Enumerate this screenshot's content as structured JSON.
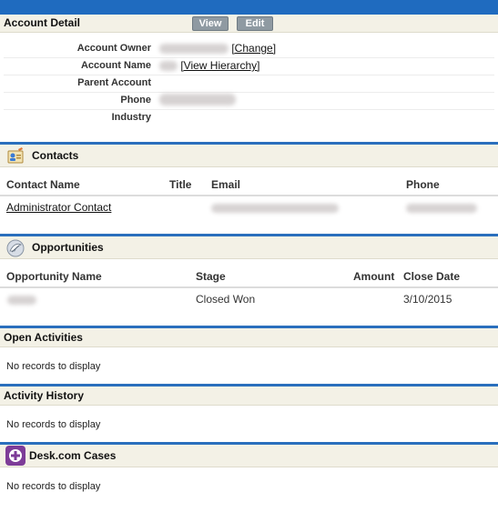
{
  "detail": {
    "title": "Account Detail",
    "view_label": "View",
    "edit_label": "Edit",
    "fields": {
      "owner_label": "Account Owner",
      "change_link": "[Change]",
      "name_label": "Account Name",
      "hierarchy_link": "[View Hierarchy]",
      "parent_label": "Parent Account",
      "phone_label": "Phone",
      "industry_label": "Industry"
    }
  },
  "contacts": {
    "title": "Contacts",
    "icon": "contacts-icon",
    "col_name": "Contact Name",
    "col_title": "Title",
    "col_email": "Email",
    "col_phone": "Phone",
    "rows": [
      {
        "name": "Administrator Contact"
      }
    ]
  },
  "opportunities": {
    "title": "Opportunities",
    "icon": "opportunities-icon",
    "col_name": "Opportunity Name",
    "col_stage": "Stage",
    "col_amount": "Amount",
    "col_close": "Close Date",
    "rows": [
      {
        "stage": "Closed Won",
        "close_date": "3/10/2015"
      }
    ]
  },
  "open_activities": {
    "title": "Open Activities",
    "empty": "No records to display"
  },
  "activity_history": {
    "title": "Activity History",
    "empty": "No records to display"
  },
  "desk_cases": {
    "title": "Desk.com Cases",
    "icon": "desk-cases-icon",
    "empty": "No records to display"
  },
  "colors": {
    "accent": "#1f6bbf",
    "band": "#f3f1e6",
    "button": "#8f9aa2",
    "desk": "#7d3c98"
  }
}
